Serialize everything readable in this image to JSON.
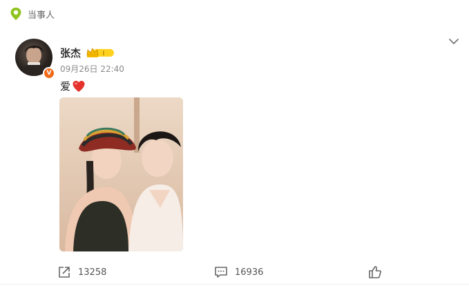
{
  "header": {
    "tag_label": "当事人"
  },
  "post": {
    "author": "张杰",
    "timestamp": "09月26日 22:40",
    "text": "爱",
    "verified_badge": "V"
  },
  "actions": {
    "share_count": "13258",
    "comment_count": "16936"
  },
  "colors": {
    "tag_green": "#8fc31f",
    "verified_orange": "#f06a1a",
    "crown_gold": "#f5b800",
    "heart_red": "#e5322d"
  },
  "icons": [
    "location-pin-icon",
    "chevron-down-icon",
    "crown-badge-icon",
    "heart-icon",
    "share-icon",
    "comment-icon",
    "like-icon"
  ]
}
